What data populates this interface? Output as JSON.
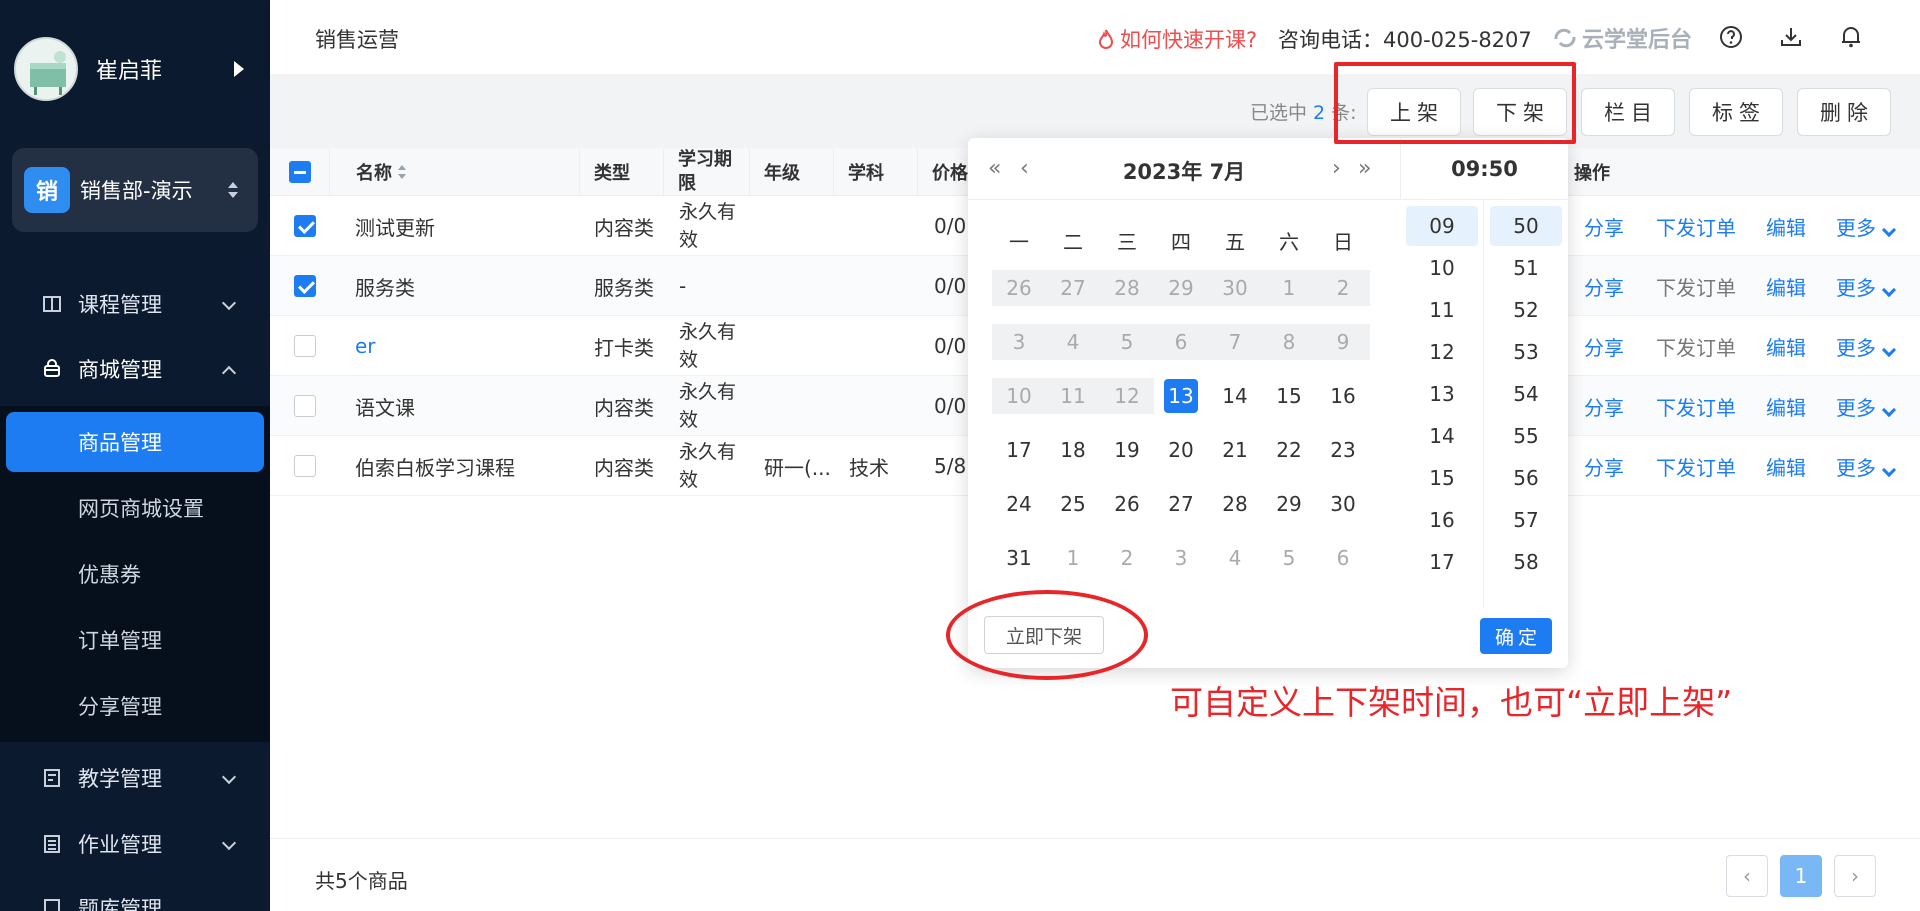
{
  "sidebar": {
    "user_name": "崔启菲",
    "dept_badge": "销",
    "dept_name": "销售部-演示",
    "menu": [
      {
        "label": "课程管理"
      },
      {
        "label": "商城管理"
      },
      {
        "label": "教学管理"
      },
      {
        "label": "作业管理"
      },
      {
        "label": "题库管理"
      }
    ],
    "submenu": [
      {
        "label": "商品管理"
      },
      {
        "label": "网页商城设置"
      },
      {
        "label": "优惠券"
      },
      {
        "label": "订单管理"
      },
      {
        "label": "分享管理"
      }
    ]
  },
  "header": {
    "title": "销售运营",
    "quick_link": "如何快速开课?",
    "hotline": "咨询电话：400-025-8207",
    "brand": "云学堂后台"
  },
  "toolbar": {
    "selected_prefix": "已选中",
    "selected_count": "2",
    "selected_suffix": "条:",
    "buttons": [
      "上架",
      "下架",
      "栏目",
      "标签",
      "删除"
    ]
  },
  "table": {
    "headers": [
      "名称",
      "类型",
      "学习期限",
      "年级",
      "学科",
      "价格",
      "操作"
    ],
    "rows": [
      {
        "name": "测试更新",
        "type": "内容类",
        "period": "永久有效",
        "grade": "",
        "subject": "",
        "price": "0/0",
        "checked": true
      },
      {
        "name": "服务类",
        "type": "服务类",
        "period": "-",
        "grade": "",
        "subject": "",
        "price": "0/0",
        "checked": true
      },
      {
        "name": "er",
        "type": "打卡类",
        "period": "永久有效",
        "grade": "",
        "subject": "",
        "price": "0/0",
        "checked": false
      },
      {
        "name": "语文课",
        "type": "内容类",
        "period": "永久有效",
        "grade": "",
        "subject": "",
        "price": "0/0",
        "checked": false
      },
      {
        "name": "伯索白板学习课程",
        "type": "内容类",
        "period": "永久有效",
        "grade": "研一(...",
        "subject": "技术",
        "price": "5/8",
        "checked": false
      }
    ],
    "ops": {
      "share": "分享",
      "order": "下发订单",
      "edit": "编辑",
      "more": "更多"
    }
  },
  "picker": {
    "title": "2023年  7月",
    "time": "09:50",
    "weekdays": [
      "一",
      "二",
      "三",
      "四",
      "五",
      "六",
      "日"
    ],
    "weeks": [
      [
        "26",
        "27",
        "28",
        "29",
        "30",
        "1",
        "2"
      ],
      [
        "3",
        "4",
        "5",
        "6",
        "7",
        "8",
        "9"
      ],
      [
        "10",
        "11",
        "12",
        "13",
        "14",
        "15",
        "16"
      ],
      [
        "17",
        "18",
        "19",
        "20",
        "21",
        "22",
        "23"
      ],
      [
        "24",
        "25",
        "26",
        "27",
        "28",
        "29",
        "30"
      ],
      [
        "31",
        "1",
        "2",
        "3",
        "4",
        "5",
        "6"
      ]
    ],
    "selected_day": "13",
    "hours": [
      "09",
      "10",
      "11",
      "12",
      "13",
      "14",
      "15",
      "16",
      "17"
    ],
    "minutes": [
      "50",
      "51",
      "52",
      "53",
      "54",
      "55",
      "56",
      "57",
      "58"
    ],
    "immediate_label": "立即下架",
    "confirm_label": "确定"
  },
  "annotation": "可自定义上下架时间，也可“立即上架”",
  "footer": {
    "total": "共5个商品",
    "current_page": "1"
  },
  "colors": {
    "primary": "#1e7cf2",
    "sidebar_bg": "#0b1a2e",
    "annotation_red": "#e8262a"
  }
}
